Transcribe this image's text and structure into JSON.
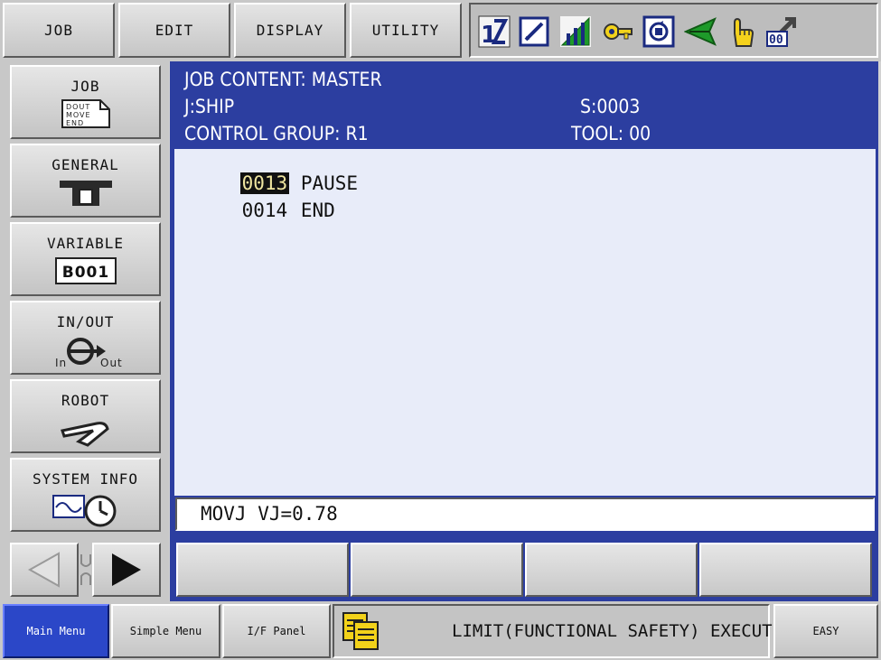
{
  "top_menu": {
    "job": "JOB",
    "edit": "EDIT",
    "display": "DISPLAY",
    "utility": "UTILITY"
  },
  "status_icons": [
    "axis-toggle-icon",
    "edit-mode-icon",
    "signal-level-icon",
    "security-key-icon",
    "cycle-mode-icon",
    "play-mode-icon",
    "hand-servo-icon",
    "step-mode-icon"
  ],
  "side_menu": {
    "job": {
      "label": "JOB",
      "icon_text": [
        "DOUT",
        "MOVE",
        "END"
      ]
    },
    "general": {
      "label": "GENERAL"
    },
    "variable": {
      "label": "VARIABLE",
      "icon_text": "B001"
    },
    "inout": {
      "label": "IN/OUT",
      "icon_in": "In",
      "icon_out": "Out"
    },
    "robot": {
      "label": "ROBOT"
    },
    "system_info": {
      "label": "SYSTEM INFO"
    }
  },
  "job_header": {
    "title": "JOB CONTENT: MASTER",
    "job": "J:SHIP",
    "step": "S:0003",
    "control_group": "CONTROL GROUP: R1",
    "tool": "TOOL: 00"
  },
  "job_lines": [
    {
      "number": "0013",
      "instruction": "PAUSE",
      "active": true
    },
    {
      "number": "0014",
      "instruction": "END",
      "active": false
    }
  ],
  "edit_buffer": "MOVJ VJ=0.78",
  "bottom_bar": {
    "main_menu": "Main Menu",
    "simple_menu": "Simple Menu",
    "if_panel": "I/F Panel",
    "message": "LIMIT(FUNCTIONAL SAFETY) EXECUTE",
    "easy": "EASY"
  },
  "colors": {
    "header_bg": "#2c3ea0",
    "content_bg": "#e8ecf9",
    "active_tab": "#2b47c8",
    "cursor_bg": "#111111",
    "cursor_fg": "#f0e6a0"
  }
}
